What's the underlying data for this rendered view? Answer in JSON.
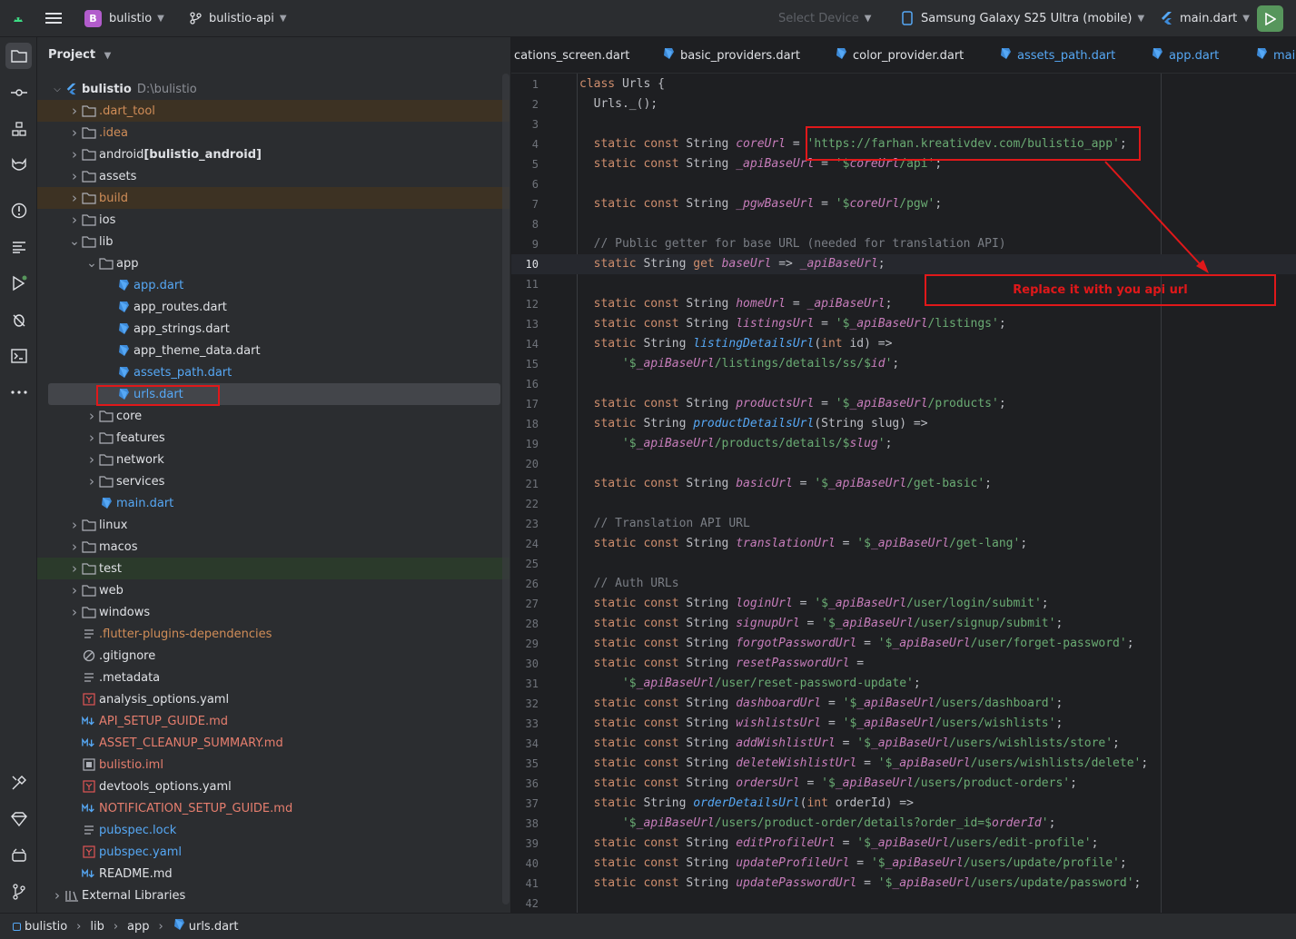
{
  "titlebar": {
    "project_badge": "B",
    "project_name": "bulistio",
    "branch": "bulistio-api",
    "select_device": "Select Device",
    "device": "Samsung Galaxy S25 Ultra (mobile)",
    "run_config": "main.dart"
  },
  "project_panel": {
    "title": "Project",
    "root_name": "bulistio",
    "root_path": "D:\\bulistio",
    "tree": [
      {
        "label": ".dart_tool",
        "icon": "folder-icon",
        "color": "#d08d58"
      },
      {
        "label": ".idea",
        "icon": "folder-icon",
        "color": "#d08d58"
      },
      {
        "label": "android",
        "suffix": "[bulistio_android]",
        "icon": "folder-icon",
        "color": "#dfe1e5"
      },
      {
        "label": "assets",
        "icon": "folder-icon",
        "color": "#dfe1e5"
      },
      {
        "label": "build",
        "icon": "folder-icon",
        "color": "#d08d58"
      },
      {
        "label": "ios",
        "icon": "folder-icon",
        "color": "#dfe1e5"
      },
      {
        "label": "lib",
        "icon": "folder-icon",
        "color": "#dfe1e5"
      },
      {
        "label": "app",
        "icon": "folder-icon",
        "color": "#dfe1e5"
      },
      {
        "label": "app.dart",
        "icon": "dart-file-icon",
        "color": "#56a8f5"
      },
      {
        "label": "app_routes.dart",
        "icon": "dart-file-icon",
        "color": "#dfe1e5"
      },
      {
        "label": "app_strings.dart",
        "icon": "dart-file-icon",
        "color": "#dfe1e5"
      },
      {
        "label": "app_theme_data.dart",
        "icon": "dart-file-icon",
        "color": "#dfe1e5"
      },
      {
        "label": "assets_path.dart",
        "icon": "dart-file-icon",
        "color": "#56a8f5"
      },
      {
        "label": "urls.dart",
        "icon": "dart-file-icon",
        "color": "#56a8f5"
      },
      {
        "label": "core",
        "icon": "folder-icon",
        "color": "#dfe1e5"
      },
      {
        "label": "features",
        "icon": "folder-icon",
        "color": "#dfe1e5"
      },
      {
        "label": "network",
        "icon": "folder-icon",
        "color": "#dfe1e5"
      },
      {
        "label": "services",
        "icon": "folder-icon",
        "color": "#dfe1e5"
      },
      {
        "label": "main.dart",
        "icon": "dart-file-icon",
        "color": "#56a8f5"
      },
      {
        "label": "linux",
        "icon": "folder-icon",
        "color": "#dfe1e5"
      },
      {
        "label": "macos",
        "icon": "folder-icon",
        "color": "#dfe1e5"
      },
      {
        "label": "test",
        "icon": "folder-icon",
        "color": "#dfe1e5"
      },
      {
        "label": "web",
        "icon": "folder-icon",
        "color": "#dfe1e5"
      },
      {
        "label": "windows",
        "icon": "folder-icon",
        "color": "#dfe1e5"
      },
      {
        "label": ".flutter-plugins-dependencies",
        "icon": "text-file-icon",
        "color": "#d08d58"
      },
      {
        "label": ".gitignore",
        "icon": "ignore-file-icon",
        "color": "#dfe1e5"
      },
      {
        "label": ".metadata",
        "icon": "text-file-icon",
        "color": "#dfe1e5"
      },
      {
        "label": "analysis_options.yaml",
        "icon": "yaml-file-icon",
        "color": "#dfe1e5"
      },
      {
        "label": "API_SETUP_GUIDE.md",
        "icon": "markdown-file-icon",
        "color": "#e67e6e"
      },
      {
        "label": "ASSET_CLEANUP_SUMMARY.md",
        "icon": "markdown-file-icon",
        "color": "#e67e6e"
      },
      {
        "label": "bulistio.iml",
        "icon": "module-file-icon",
        "color": "#e67e6e"
      },
      {
        "label": "devtools_options.yaml",
        "icon": "yaml-file-icon",
        "color": "#dfe1e5"
      },
      {
        "label": "NOTIFICATION_SETUP_GUIDE.md",
        "icon": "markdown-file-icon",
        "color": "#e67e6e"
      },
      {
        "label": "pubspec.lock",
        "icon": "text-file-icon",
        "color": "#56a8f5"
      },
      {
        "label": "pubspec.yaml",
        "icon": "yaml-file-icon",
        "color": "#56a8f5"
      },
      {
        "label": "README.md",
        "icon": "markdown-file-icon",
        "color": "#dfe1e5"
      },
      {
        "label": "External Libraries",
        "icon": "library-icon",
        "color": "#dfe1e5"
      }
    ]
  },
  "tabs": [
    "cations_screen.dart",
    "basic_providers.dart",
    "color_provider.dart",
    "assets_path.dart",
    "app.dart",
    "main"
  ],
  "code_lines": [
    "class Urls {",
    "  Urls._();",
    "",
    "  static const String coreUrl = 'https://farhan.kreativdev.com/bulistio_app';",
    "  static const String _apiBaseUrl = '$coreUrl/api';",
    "",
    "  static const String _pgwBaseUrl = '$coreUrl/pgw';",
    "",
    "  // Public getter for base URL (needed for translation API)",
    "  static String get baseUrl => _apiBaseUrl;",
    "",
    "  static const String homeUrl = _apiBaseUrl;",
    "  static const String listingsUrl = '$_apiBaseUrl/listings';",
    "  static String listingDetailsUrl(int id) =>",
    "      '$_apiBaseUrl/listings/details/ss/$id';",
    "",
    "  static const String productsUrl = '$_apiBaseUrl/products';",
    "  static String productDetailsUrl(String slug) =>",
    "      '$_apiBaseUrl/products/details/$slug';",
    "",
    "  static const String basicUrl = '$_apiBaseUrl/get-basic';",
    "",
    "  // Translation API URL",
    "  static const String translationUrl = '$_apiBaseUrl/get-lang';",
    "",
    "  // Auth URLs",
    "  static const String loginUrl = '$_apiBaseUrl/user/login/submit';",
    "  static const String signupUrl = '$_apiBaseUrl/user/signup/submit';",
    "  static const String forgotPasswordUrl = '$_apiBaseUrl/user/forget-password';",
    "  static const String resetPasswordUrl =",
    "      '$_apiBaseUrl/user/reset-password-update';",
    "  static const String dashboardUrl = '$_apiBaseUrl/users/dashboard';",
    "  static const String wishlistsUrl = '$_apiBaseUrl/users/wishlists';",
    "  static const String addWishlistUrl = '$_apiBaseUrl/users/wishlists/store';",
    "  static const String deleteWishlistUrl = '$_apiBaseUrl/users/wishlists/delete';",
    "  static const String ordersUrl = '$_apiBaseUrl/users/product-orders';",
    "  static String orderDetailsUrl(int orderId) =>",
    "      '$_apiBaseUrl/users/product-order/details?order_id=$orderId';",
    "  static const String editProfileUrl = '$_apiBaseUrl/users/edit-profile';",
    "  static const String updateProfileUrl = '$_apiBaseUrl/users/update/profile';",
    "  static const String updatePasswordUrl = '$_apiBaseUrl/users/update/password';",
    ""
  ],
  "annotation": {
    "note": "Replace it with you api url"
  },
  "breadcrumb": [
    "bulistio",
    "lib",
    "app",
    "urls.dart"
  ],
  "colors": {
    "annotation_red": "#e0181a",
    "run_green": "#57965c",
    "badge_purple": "#b25ccc"
  }
}
